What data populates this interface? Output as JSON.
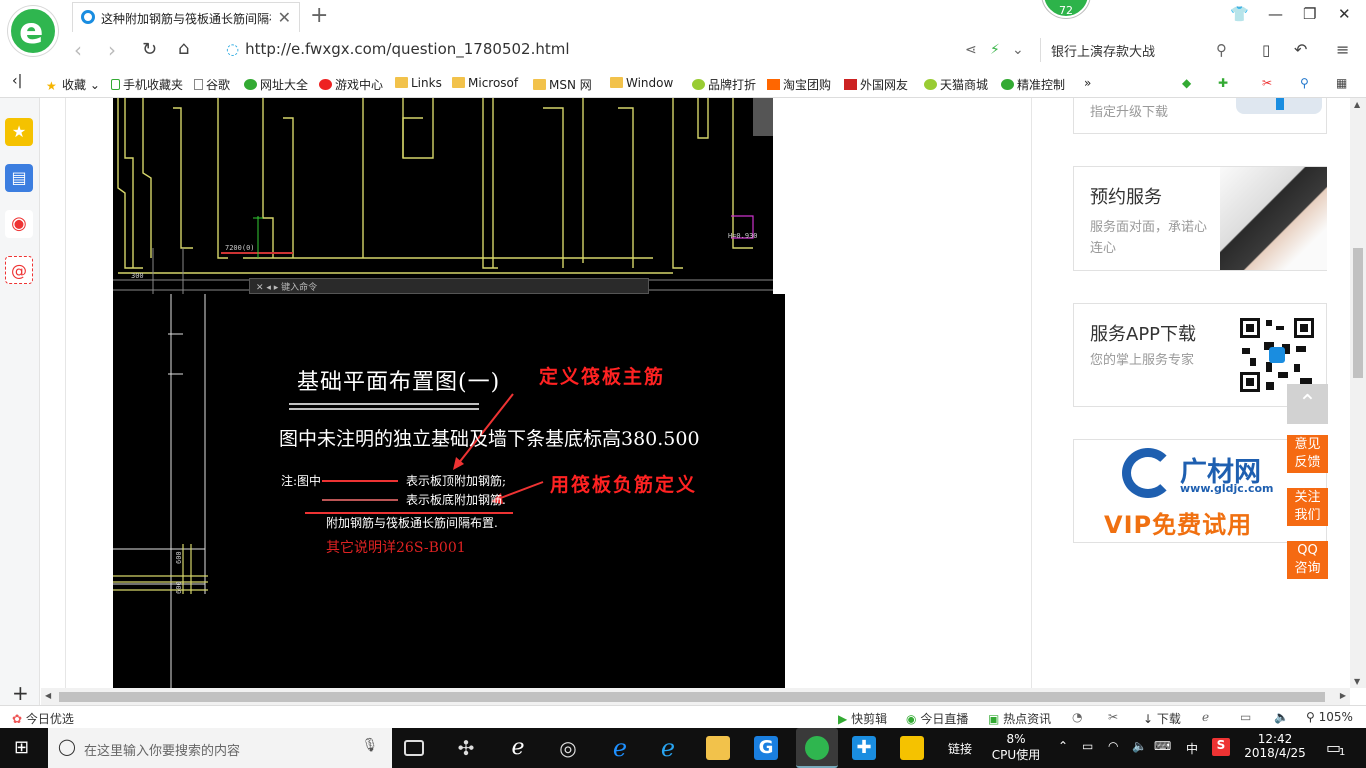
{
  "browser": {
    "tab_title": "这种附加钢筋与筏板通长筋间隔布置",
    "badge_count": "72",
    "url": "http://e.fwxgx.com/question_1780502.html",
    "search_text": "银行上演存款大战"
  },
  "bookmarks": [
    "收藏",
    "手机收藏夹",
    "谷歌",
    "网址大全",
    "游戏中心",
    "Links",
    "Microsof",
    "MSN 网",
    "Window",
    "品牌打折",
    "淘宝团购",
    "外国网友",
    "天猫商城",
    "精准控制"
  ],
  "cad": {
    "title": "基础平面布置图(一)",
    "note_line1": "图中未注明的独立基础及墙下条基底标高380.500",
    "legend_prefix": "注:图中",
    "legend_top": "表示板顶附加钢筋;",
    "legend_bottom": "表示板底附加钢筋.",
    "legend_extra": "附加钢筋与筏板通长筋间隔布置.",
    "legend_ref": "其它说明详26S-B001",
    "annot_top": "定义筏板主筋",
    "annot_bottom": "用筏板负筋定义",
    "cmd_prompt": "键入命令"
  },
  "sidebar_cards": [
    {
      "title": "",
      "desc": "指定升级下载"
    },
    {
      "title": "预约服务",
      "desc": "服务面对面，承诺心连心"
    },
    {
      "title": "服务APP下载",
      "desc": "您的掌上服务专家"
    },
    {
      "title": "广材网",
      "desc": "www.gldjc.com",
      "promo": "VIP免费试用"
    }
  ],
  "float_buttons": [
    "意见反馈",
    "关注我们",
    "QQ咨询"
  ],
  "statusbar": {
    "left": "今日优选",
    "items": [
      "快剪辑",
      "今日直播",
      "热点资讯",
      "下载"
    ],
    "zoom": "105%"
  },
  "taskbar": {
    "search_placeholder": "在这里输入你要搜索的内容",
    "link": "链接",
    "cpu_percent": "8%",
    "cpu_label": "CPU使用",
    "ime": "中",
    "time": "12:42",
    "date": "2018/4/25",
    "notif": "1"
  }
}
